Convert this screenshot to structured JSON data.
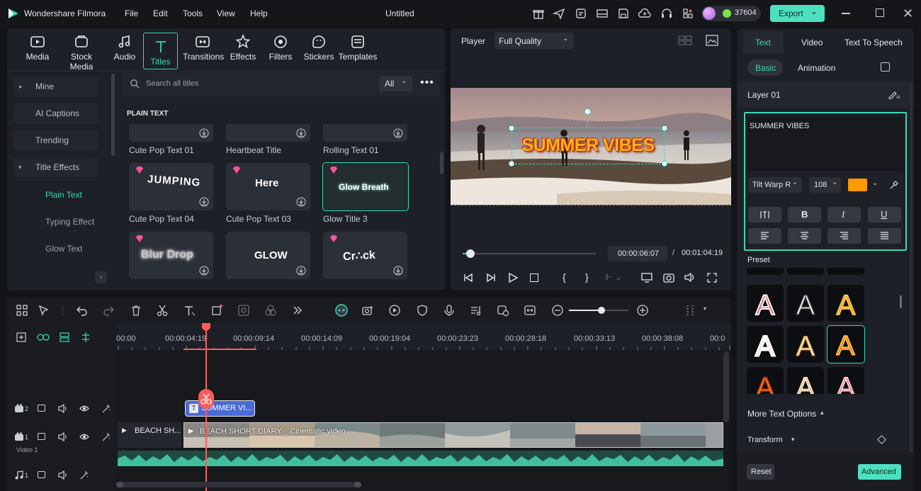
{
  "app": {
    "name": "Wondershare Filmora",
    "title": "Untitled",
    "credits": "37604",
    "export": "Export"
  },
  "menu": [
    "File",
    "Edit",
    "Tools",
    "View",
    "Help"
  ],
  "toolbar": {
    "items": [
      "Media",
      "Stock Media",
      "Audio",
      "Titles",
      "Transitions",
      "Effects",
      "Filters",
      "Stickers",
      "Templates"
    ]
  },
  "sidebar": {
    "items": [
      "Mine",
      "AI Captions",
      "Trending",
      "Title Effects"
    ],
    "sub_items": [
      "Plain Text",
      "Typing Effect",
      "Glow Text"
    ]
  },
  "browser": {
    "search_placeholder": "Search all titles",
    "filter": "All",
    "section": "PLAIN TEXT",
    "row0": [
      "Cute Pop Text 01",
      "Heartbeat Title",
      "Rolling Text 01"
    ],
    "row1": [
      {
        "label": "Cute Pop Text 04",
        "text": "JUMPING"
      },
      {
        "label": "Cute Pop Text 03",
        "text": "Here"
      },
      {
        "label": "Glow Title 3",
        "text": "Glow Breath"
      }
    ],
    "row2": [
      {
        "text": "Blur Drop"
      },
      {
        "text": "GLOW"
      },
      {
        "text": "Cr∴ck"
      }
    ]
  },
  "player": {
    "label": "Player",
    "quality": "Full Quality",
    "overlay_text": "SUMMER VIBES",
    "current": "00:00:06:07",
    "sep": "/",
    "total": "00:01:04:19",
    "progress": 0.06
  },
  "props": {
    "tabs": [
      "Text",
      "Video",
      "Text To Speech"
    ],
    "subtabs": [
      "Basic",
      "Animation"
    ],
    "layer": "Layer 01",
    "text_value": "SUMMER VIBES",
    "font": "Tilt Warp R",
    "size": "108",
    "color": "#ff9a00",
    "preset_label": "Preset",
    "more": "More Text Options",
    "transform": "Transform",
    "reset": "Reset",
    "advanced": "Advanced"
  },
  "timeline": {
    "ruler": [
      "00:00",
      "00:00:04:19",
      "00:00:09:14",
      "00:00:14:09",
      "00:00:19:04",
      "00:00:23:23",
      "00:00:28:18",
      "00:00:33:13",
      "00:00:38:08",
      "00:0"
    ],
    "title_clip": "SUMMER VI...",
    "video_clip1": "BEACH SH...",
    "video_clip2": "BEACH SHORT DIARY _ Cinematic video",
    "track_video_label": "Video 1",
    "track_nums": [
      "2",
      "1",
      "1"
    ],
    "zoom": 0.55
  },
  "colors": {
    "accent": "#38d8b4",
    "export_bg": "#4ee0be",
    "playhead": "#ff5a5a",
    "title_clip": "#4a6ad6"
  }
}
